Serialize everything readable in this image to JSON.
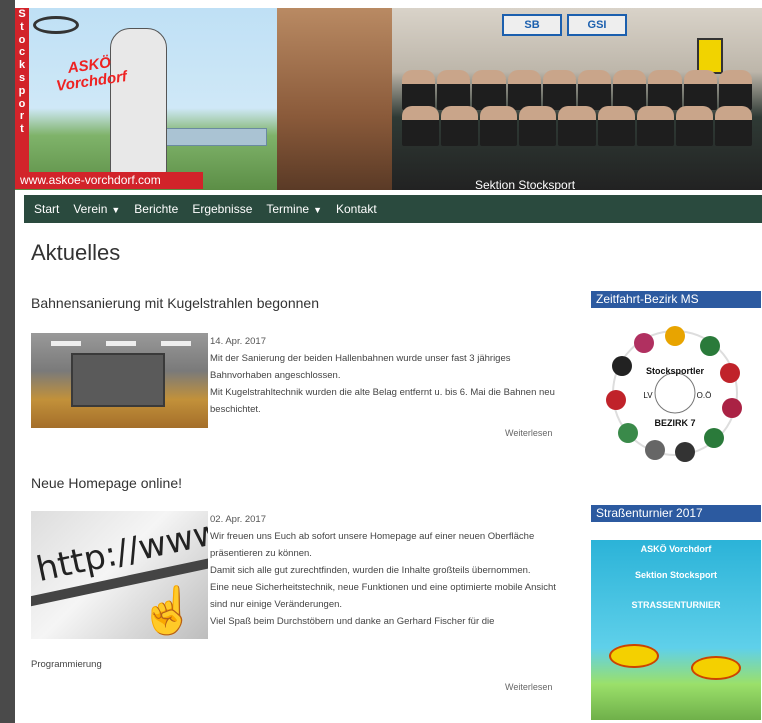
{
  "header": {
    "vertical_text": [
      "S",
      "t",
      "o",
      "c",
      "k",
      "s",
      "p",
      "o",
      "r",
      "t"
    ],
    "logo_text": [
      "ASKÖ",
      "Vorchdorf"
    ],
    "url": "www.askoe-vorchdorf.com",
    "section_caption": "Sektion Stocksport",
    "sponsors": [
      "SB",
      "GSI"
    ]
  },
  "nav": {
    "items": [
      {
        "label": "Start",
        "dropdown": false
      },
      {
        "label": "Verein",
        "dropdown": true
      },
      {
        "label": "Berichte",
        "dropdown": false
      },
      {
        "label": "Ergebnisse",
        "dropdown": false
      },
      {
        "label": "Termine",
        "dropdown": true
      },
      {
        "label": "Kontakt",
        "dropdown": false
      }
    ],
    "caret": "▼"
  },
  "main": {
    "title": "Aktuelles",
    "articles": [
      {
        "title": "Bahnensanierung mit Kugelstrahlen begonnen",
        "date": "14. Apr. 2017",
        "paragraphs": [
          "Mit der Sanierung der beiden Hallenbahnen wurde unser fast 3 jähriges Bahnvorhaben angeschlossen.",
          "Mit Kugelstrahltechnik wurden die alte Belag entfernt u. bis 6. Mai die Bahnen neu beschichtet."
        ],
        "more": "Weiterlesen"
      },
      {
        "title": "Neue Homepage online!",
        "date": "02. Apr. 2017",
        "paragraphs": [
          "Wir freuen uns Euch ab sofort unsere Homepage auf einer neuen Oberfläche präsentieren zu können.",
          "Damit sich alle gut zurechtfinden, wurden die Inhalte großteils übernommen.",
          "Eine neue Sicherheitstechnik, neue Funktionen und eine optimierte mobile Ansicht sind nur einige Veränderungen.",
          "Viel Spaß beim Durchstöbern und danke an Gerhard Fischer für die"
        ],
        "overflow": "Programmierung",
        "more": "Weiterlesen"
      }
    ]
  },
  "sidebar": {
    "widget1_title": "Zeitfahrt-Bezirk MS",
    "badge": {
      "top": "Stocksportler",
      "left": "LV",
      "right": "O.Ö",
      "bottom": "BEZIRK 7"
    },
    "widget2_title": "Straßenturnier 2017",
    "poster_lines": [
      "ASKÖ Vorchdorf",
      "Sektion Stocksport",
      "STRASSENTURNIER"
    ]
  },
  "colors": {
    "nav_bg": "#2a4a3e",
    "sidebar_head": "#2c5aa0",
    "brand_red": "#d2232a"
  }
}
